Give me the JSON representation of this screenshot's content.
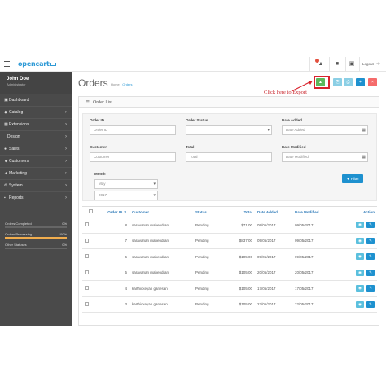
{
  "header": {
    "logo": "opencart",
    "logout": "Logout"
  },
  "sidebar": {
    "user_name": "John Doe",
    "user_role": "Administrator",
    "items": [
      {
        "label": "Dashboard",
        "icon": "dashboard-icon",
        "chevron": false,
        "sub": false
      },
      {
        "label": "Catalog",
        "icon": "tag-icon",
        "chevron": true,
        "sub": false
      },
      {
        "label": "Extensions",
        "icon": "puzzle-icon",
        "chevron": true,
        "sub": false
      },
      {
        "label": "Design",
        "icon": "",
        "chevron": true,
        "sub": true
      },
      {
        "label": "Sales",
        "icon": "cart-icon",
        "chevron": true,
        "sub": false
      },
      {
        "label": "Customers",
        "icon": "user-icon",
        "chevron": true,
        "sub": false
      },
      {
        "label": "Marketing",
        "icon": "share-icon",
        "chevron": true,
        "sub": false
      },
      {
        "label": "System",
        "icon": "cog-icon",
        "chevron": true,
        "sub": false
      },
      {
        "label": "Reports",
        "icon": "chart-icon",
        "chevron": true,
        "sub": false
      }
    ],
    "stats": [
      {
        "label": "Orders Completed",
        "value": "0%",
        "fill": 0
      },
      {
        "label": "Orders Processing",
        "value": "100%",
        "fill": 1
      },
      {
        "label": "Other Statuses",
        "value": "0%",
        "fill": 0
      }
    ]
  },
  "page": {
    "title": "Orders",
    "breadcrumb_home": "Home",
    "breadcrumb_current": "Orders",
    "callout": "Click here to Export",
    "toolbar_colors": {
      "export": "#5cb85c",
      "light": "#8bcfe5",
      "add": "#1e91cf",
      "delete": "#f56b6b"
    }
  },
  "panel": {
    "title": "Order List"
  },
  "filters": {
    "order_id_label": "Order ID",
    "order_id_placeholder": "Order ID",
    "order_status_label": "Order Status",
    "date_added_label": "Date Added",
    "date_added_placeholder": "Date Added",
    "customer_label": "Customer",
    "customer_placeholder": "Customer",
    "total_label": "Total",
    "total_placeholder": "Total",
    "date_modified_label": "Date Modified",
    "date_modified_placeholder": "Date Modified",
    "month_label": "Month",
    "month_value": "May",
    "year_value": "2017",
    "filter_button": "Filter"
  },
  "table": {
    "headers": {
      "order_id": "Order ID ▼",
      "customer": "Customer",
      "status": "Status",
      "total": "Total",
      "date_added": "Date Added",
      "date_modified": "Date Modified",
      "action": "Action"
    },
    "rows": [
      {
        "order_id": "8",
        "customer": "saravanan mahendran",
        "status": "Pending",
        "total": "$71.00",
        "date_added": "09/05/2017",
        "date_modified": "09/05/2017"
      },
      {
        "order_id": "7",
        "customer": "saravanan mahendran",
        "status": "Pending",
        "total": "$837.00",
        "date_added": "09/05/2017",
        "date_modified": "09/05/2017"
      },
      {
        "order_id": "6",
        "customer": "saravanan mahendran",
        "status": "Pending",
        "total": "$105.00",
        "date_added": "09/05/2017",
        "date_modified": "09/05/2017"
      },
      {
        "order_id": "5",
        "customer": "saravanan mahendran",
        "status": "Pending",
        "total": "$105.00",
        "date_added": "20/05/2017",
        "date_modified": "20/05/2017"
      },
      {
        "order_id": "4",
        "customer": "karthickeyan ganesan",
        "status": "Pending",
        "total": "$105.00",
        "date_added": "17/05/2017",
        "date_modified": "17/05/2017"
      },
      {
        "order_id": "3",
        "customer": "karthickeyan ganesan",
        "status": "Pending",
        "total": "$105.00",
        "date_added": "22/05/2017",
        "date_modified": "22/05/2017"
      }
    ]
  }
}
